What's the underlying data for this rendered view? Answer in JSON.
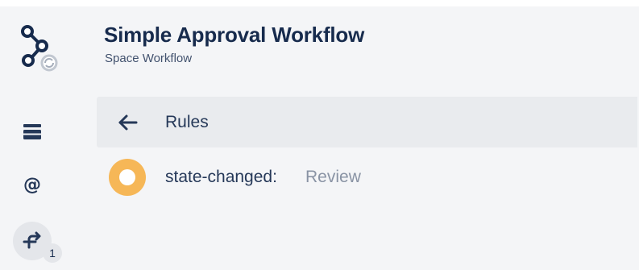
{
  "workflow": {
    "title": "Simple Approval Workflow",
    "subtitle": "Space Workflow"
  },
  "sidebar": {
    "logo_icon": "workflow-nodes-logo",
    "items": [
      {
        "icon": "panel-icon",
        "active": false
      },
      {
        "icon": "at-sign-icon",
        "glyph": "@",
        "active": false
      },
      {
        "icon": "branch-arrow-icon",
        "active": true,
        "count": "1"
      }
    ]
  },
  "rules_panel": {
    "back_icon": "arrow-left-icon",
    "label": "Rules"
  },
  "rules": [
    {
      "event": "state-changed:",
      "target": "Review",
      "status_color": "#f6b757"
    }
  ],
  "colors": {
    "background": "#f4f5f7",
    "bar": "#e9ebee",
    "text_primary": "#172b4d",
    "text_muted": "#8993a4",
    "status_inprogress": "#f6b757"
  }
}
